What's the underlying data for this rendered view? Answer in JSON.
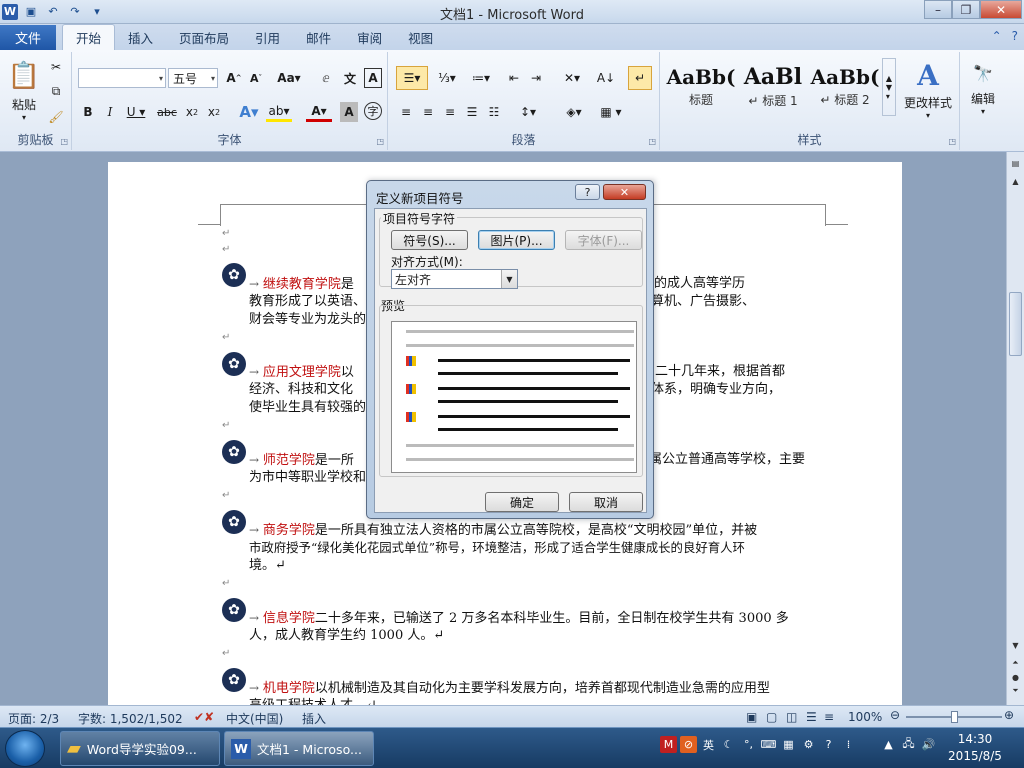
{
  "window": {
    "title": "文档1 - Microsoft Word"
  },
  "qat": {
    "icons": [
      "word-logo",
      "save-icon",
      "undo-icon",
      "redo-icon",
      "customize-icon"
    ]
  },
  "tabs": {
    "file": "文件",
    "items": [
      "开始",
      "插入",
      "页面布局",
      "引用",
      "邮件",
      "审阅",
      "视图"
    ],
    "active": "开始"
  },
  "ribbon": {
    "clipboard": {
      "label": "剪贴板",
      "paste": "粘贴"
    },
    "font": {
      "label": "字体",
      "font_name": "",
      "font_size": "五号"
    },
    "paragraph": {
      "label": "段落"
    },
    "styles": {
      "label": "样式",
      "items": [
        {
          "preview": "AaBb(",
          "caption": "标题"
        },
        {
          "preview": "AaBl",
          "caption": "↵ 标题 1"
        },
        {
          "preview": "AaBb(",
          "caption": "↵ 标题 2"
        }
      ],
      "change": "更改样式"
    },
    "editing": {
      "label": "编辑"
    }
  },
  "document": {
    "paragraphs": [
      {
        "highlight": "继续教育学院",
        "line1_rest": "是",
        "line1_tail": "学院。学院的成人高等学历",
        "line2": "教育形成了以英语、",
        "line2_tail": "专业和计算机、广告摄影、",
        "line3": "财会等专业为龙头的"
      },
      {
        "highlight": "应用文理学院",
        "line1_rest": "以",
        "line1_tail": "旨。二十几年来，根据首都",
        "line2": "经济、科技和文化",
        "line2_tail": "课程体系，明确专业方向，",
        "line3": "使毕业生具有较强的"
      },
      {
        "highlight": "师范学院",
        "line1_rest": "是一所",
        "line1_tail": "属公立普通高等学校，主要",
        "line2": "为市中等职业学校和",
        "line2_tail": "",
        "line3": ""
      },
      {
        "highlight": "商务学院",
        "line1_rest": "是一所具有独立法人资格的市属公立高等院校，是高校“文明校园”单位，并被",
        "line1_tail": "",
        "line2": "市政府授予“绿化美化花园式单位”称号，环境整洁，形成了适合学生健康成长的良好育人环",
        "line2_tail": "",
        "line3": "境。↵"
      },
      {
        "highlight": "信息学院",
        "line1_rest": "二十多年来，已输送了 2 万多名本科毕业生。目前，全日制在校学生共有 3000 多",
        "line1_tail": "",
        "line2": "人，成人教育学生约 1000 人。↵",
        "line2_tail": "",
        "line3": ""
      },
      {
        "highlight": "机电学院",
        "line1_rest": "以机械制造及其自动化为主要学科发展方向，培养首都现代制造业急需的应用型",
        "line1_tail": "",
        "line2": "高级工程技术人才。↵",
        "line2_tail": "",
        "line3": ""
      }
    ]
  },
  "dialog": {
    "title": "定义新项目符号",
    "help": "?",
    "close": "✕",
    "group_label": "项目符号字符",
    "symbol_btn": "符号(S)...",
    "picture_btn": "图片(P)...",
    "font_btn": "字体(F)...",
    "align_label": "对齐方式(M):",
    "align_value": "左对齐",
    "preview_label": "预览",
    "ok": "确定",
    "cancel": "取消"
  },
  "statusbar": {
    "page": "页面: 2/3",
    "words": "字数: 1,502/1,502",
    "lang": "中文(中国)",
    "mode": "插入",
    "zoom": "100%"
  },
  "taskbar": {
    "items": [
      {
        "label": "Word导学实验09...",
        "icon": "folder-icon"
      },
      {
        "label": "文档1 - Microso...",
        "icon": "word-icon"
      }
    ],
    "ime": "英",
    "time": "14:30",
    "date": "2015/8/5"
  },
  "colors": {
    "accent": "#2a5caa",
    "highlight_text": "#c01010",
    "bullet": "#1c2f55"
  }
}
